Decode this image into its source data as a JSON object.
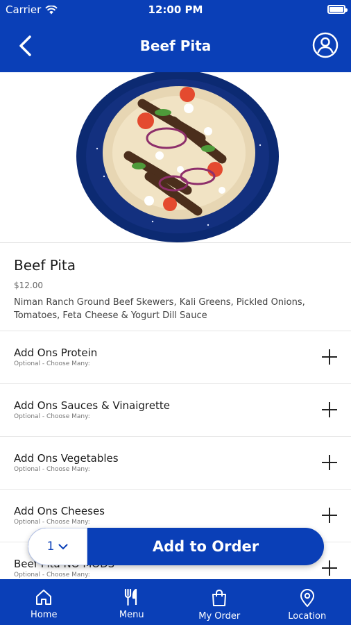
{
  "status_bar": {
    "carrier": "Carrier",
    "time": "12:00 PM"
  },
  "nav": {
    "title": "Beef Pita"
  },
  "item": {
    "name": "Beef Pita",
    "price": "$12.00",
    "description": "Niman Ranch Ground  Beef Skewers, Kali Greens, Pickled Onions, Tomatoes, Feta Cheese & Yogurt Dill Sauce"
  },
  "addons": [
    {
      "label": "Add Ons Protein",
      "sub": "Optional - Choose Many:"
    },
    {
      "label": "Add Ons Sauces & Vinaigrette",
      "sub": "Optional - Choose Many:"
    },
    {
      "label": "Add Ons Vegetables",
      "sub": "Optional - Choose Many:"
    },
    {
      "label": "Add Ons Cheeses",
      "sub": "Optional - Choose Many:"
    },
    {
      "label": "Beef Pita NO MODS",
      "sub": "Optional - Choose Many:"
    }
  ],
  "order": {
    "quantity": "1",
    "add_label": "Add to Order"
  },
  "tabs": [
    {
      "label": "Home",
      "icon": "home-icon"
    },
    {
      "label": "Menu",
      "icon": "utensils-icon"
    },
    {
      "label": "My Order",
      "icon": "bag-icon"
    },
    {
      "label": "Location",
      "icon": "location-pin-icon"
    }
  ],
  "colors": {
    "brand": "#0a3fb7"
  }
}
